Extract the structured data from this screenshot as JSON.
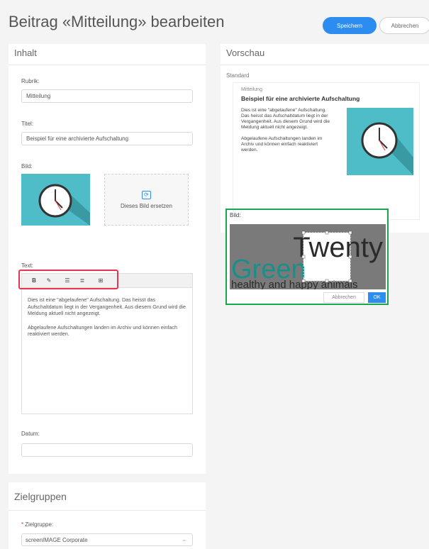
{
  "header": {
    "title": "Beitrag «Mitteilung» bearbeiten",
    "save_label": "Speichern",
    "cancel_label": "Abbrechen"
  },
  "inhalt": {
    "title": "Inhalt",
    "rubrik_label": "Rubrik:",
    "rubrik_value": "Mitteilung",
    "titel_label": "Titel:",
    "titel_value": "Beispiel für eine archivierte Aufschaltung",
    "bild_label": "Bild:",
    "replace_label": "Dieses Bild ersetzen",
    "text_label": "Text:",
    "toolbar": {
      "bold": "B",
      "highlight": "highlighter-icon",
      "bullet_list": "bullet-list-icon",
      "numbered_list": "numbered-list-icon",
      "table": "table-icon"
    },
    "editor": {
      "paragraph1": "Dies ist eine \"abgelaufene\" Aufschaltung. Das heisst das Aufschaltdatum liegt in der Vergangenheit. Aus diesem Grund wird die Meldung aktuell nicht angezeigt.",
      "paragraph2": "Abgelaufene Aufschaltungen landen im Archiv und können einfach reaktiviert werden."
    },
    "datum_label": "Datum:",
    "datum_value": ""
  },
  "vorschau": {
    "title": "Vorschau",
    "variant": "Standard",
    "rubrik": "Mitteilung",
    "headline": "Beispiel für eine archivierte Aufschaltung",
    "paragraph1": "Dies ist eine \"abgelaufene\" Aufschaltung. Das heisst das Aufschaltdatum liegt in der Vergangenheit. Aus diesem Grund wird die Meldung aktuell nicht angezeigt.",
    "paragraph2": "Abgelaufene Aufschaltungen landen im Archiv und können einfach reaktiviert werden."
  },
  "crop_dialog": {
    "label": "Bild:",
    "logo_line1": "Twenty",
    "logo_line2": "Green",
    "logo_line3": "healthy and happy animals",
    "cancel_label": "Abbrechen",
    "ok_label": "OK"
  },
  "zielgruppen": {
    "title": "Zielgruppen",
    "required_mark": "*",
    "label": "Zielgruppe:",
    "value": "screenIMAGE Corporate"
  },
  "colors": {
    "primary": "#2d8cf0",
    "teal": "#4fbdc7",
    "crop_frame": "#17a84b",
    "toolbar_highlight": "#e8344e"
  }
}
